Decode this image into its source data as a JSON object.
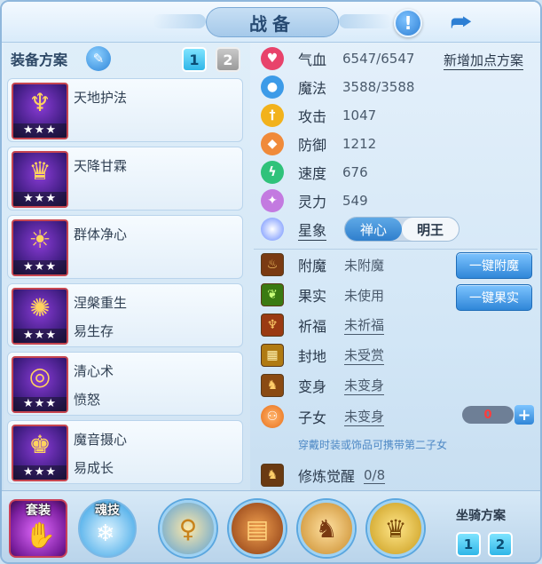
{
  "title": "战备",
  "header": {
    "info_icon": "exclamation-icon",
    "share_icon": "share-icon"
  },
  "left": {
    "heading": "装备方案",
    "pages": [
      "1",
      "2"
    ],
    "skills": [
      {
        "name": "天地护法",
        "sub": "",
        "stars": "★★★",
        "glyph": "♆"
      },
      {
        "name": "天降甘霖",
        "sub": "",
        "stars": "★★★",
        "glyph": "♛"
      },
      {
        "name": "群体净心",
        "sub": "",
        "stars": "★★★",
        "glyph": "☀"
      },
      {
        "name": "涅槃重生",
        "sub": "易生存",
        "stars": "★★★",
        "glyph": "✺"
      },
      {
        "name": "清心术",
        "sub": "愤怒",
        "stars": "★★★",
        "glyph": "◎"
      },
      {
        "name": "魔音摄心",
        "sub": "易成长",
        "stars": "★★★",
        "glyph": "♚"
      }
    ]
  },
  "stats": {
    "plan_link": "新增加点方案",
    "rows": [
      {
        "label": "气血",
        "value": "6547/6547",
        "color": "#e8436b",
        "icon": "heart-icon",
        "glyph": "♥"
      },
      {
        "label": "魔法",
        "value": "3588/3588",
        "color": "#3d9be8",
        "icon": "mana-icon",
        "glyph": "●"
      },
      {
        "label": "攻击",
        "value": "1047",
        "color": "#f2b21c",
        "icon": "attack-icon",
        "glyph": "†"
      },
      {
        "label": "防御",
        "value": "1212",
        "color": "#f08a3a",
        "icon": "shield-icon",
        "glyph": "◆"
      },
      {
        "label": "速度",
        "value": "676",
        "color": "#2fc27a",
        "icon": "speed-icon",
        "glyph": "ϟ"
      },
      {
        "label": "灵力",
        "value": "549",
        "color": "#c37ae0",
        "icon": "spirit-icon",
        "glyph": "✦"
      }
    ],
    "star": {
      "label": "星象",
      "options": [
        "禅心",
        "明王"
      ]
    }
  },
  "equip": {
    "rows": [
      {
        "label": "附魔",
        "value": "未附魔",
        "underline": false,
        "icon": "enchant-icon",
        "glyph": "♨",
        "bg": "#7a3a12"
      },
      {
        "label": "果实",
        "value": "未使用",
        "underline": false,
        "icon": "fruit-icon",
        "glyph": "❦",
        "bg": "#3a7a12"
      },
      {
        "label": "祈福",
        "value": "未祈福",
        "underline": true,
        "icon": "blessing-icon",
        "glyph": "♆",
        "bg": "#9a3a12"
      },
      {
        "label": "封地",
        "value": "未受赏",
        "underline": true,
        "icon": "fief-icon",
        "glyph": "▦",
        "bg": "#b07a12"
      },
      {
        "label": "变身",
        "value": "未变身",
        "underline": true,
        "icon": "transform-icon",
        "glyph": "♞",
        "bg": "#8a4a12"
      }
    ],
    "child": {
      "label": "子女",
      "value": "未变身",
      "count": "0",
      "icon": "child-icon"
    },
    "buttons": {
      "enchant": "一键附魔",
      "fruit": "一键果实"
    },
    "hint": "穿戴时装或饰品可携带第二子女",
    "awaken": {
      "label": "修炼觉醒",
      "value": "0/8",
      "icon": "awaken-icon"
    }
  },
  "bottom": {
    "suit_label": "套装",
    "soul_label": "魂技",
    "icons": [
      "dancer-icon",
      "wall-icon",
      "warrior-icon",
      "golden-warrior-icon"
    ],
    "mount_label": "坐骑方案",
    "mount_pages": [
      "1",
      "2"
    ]
  }
}
